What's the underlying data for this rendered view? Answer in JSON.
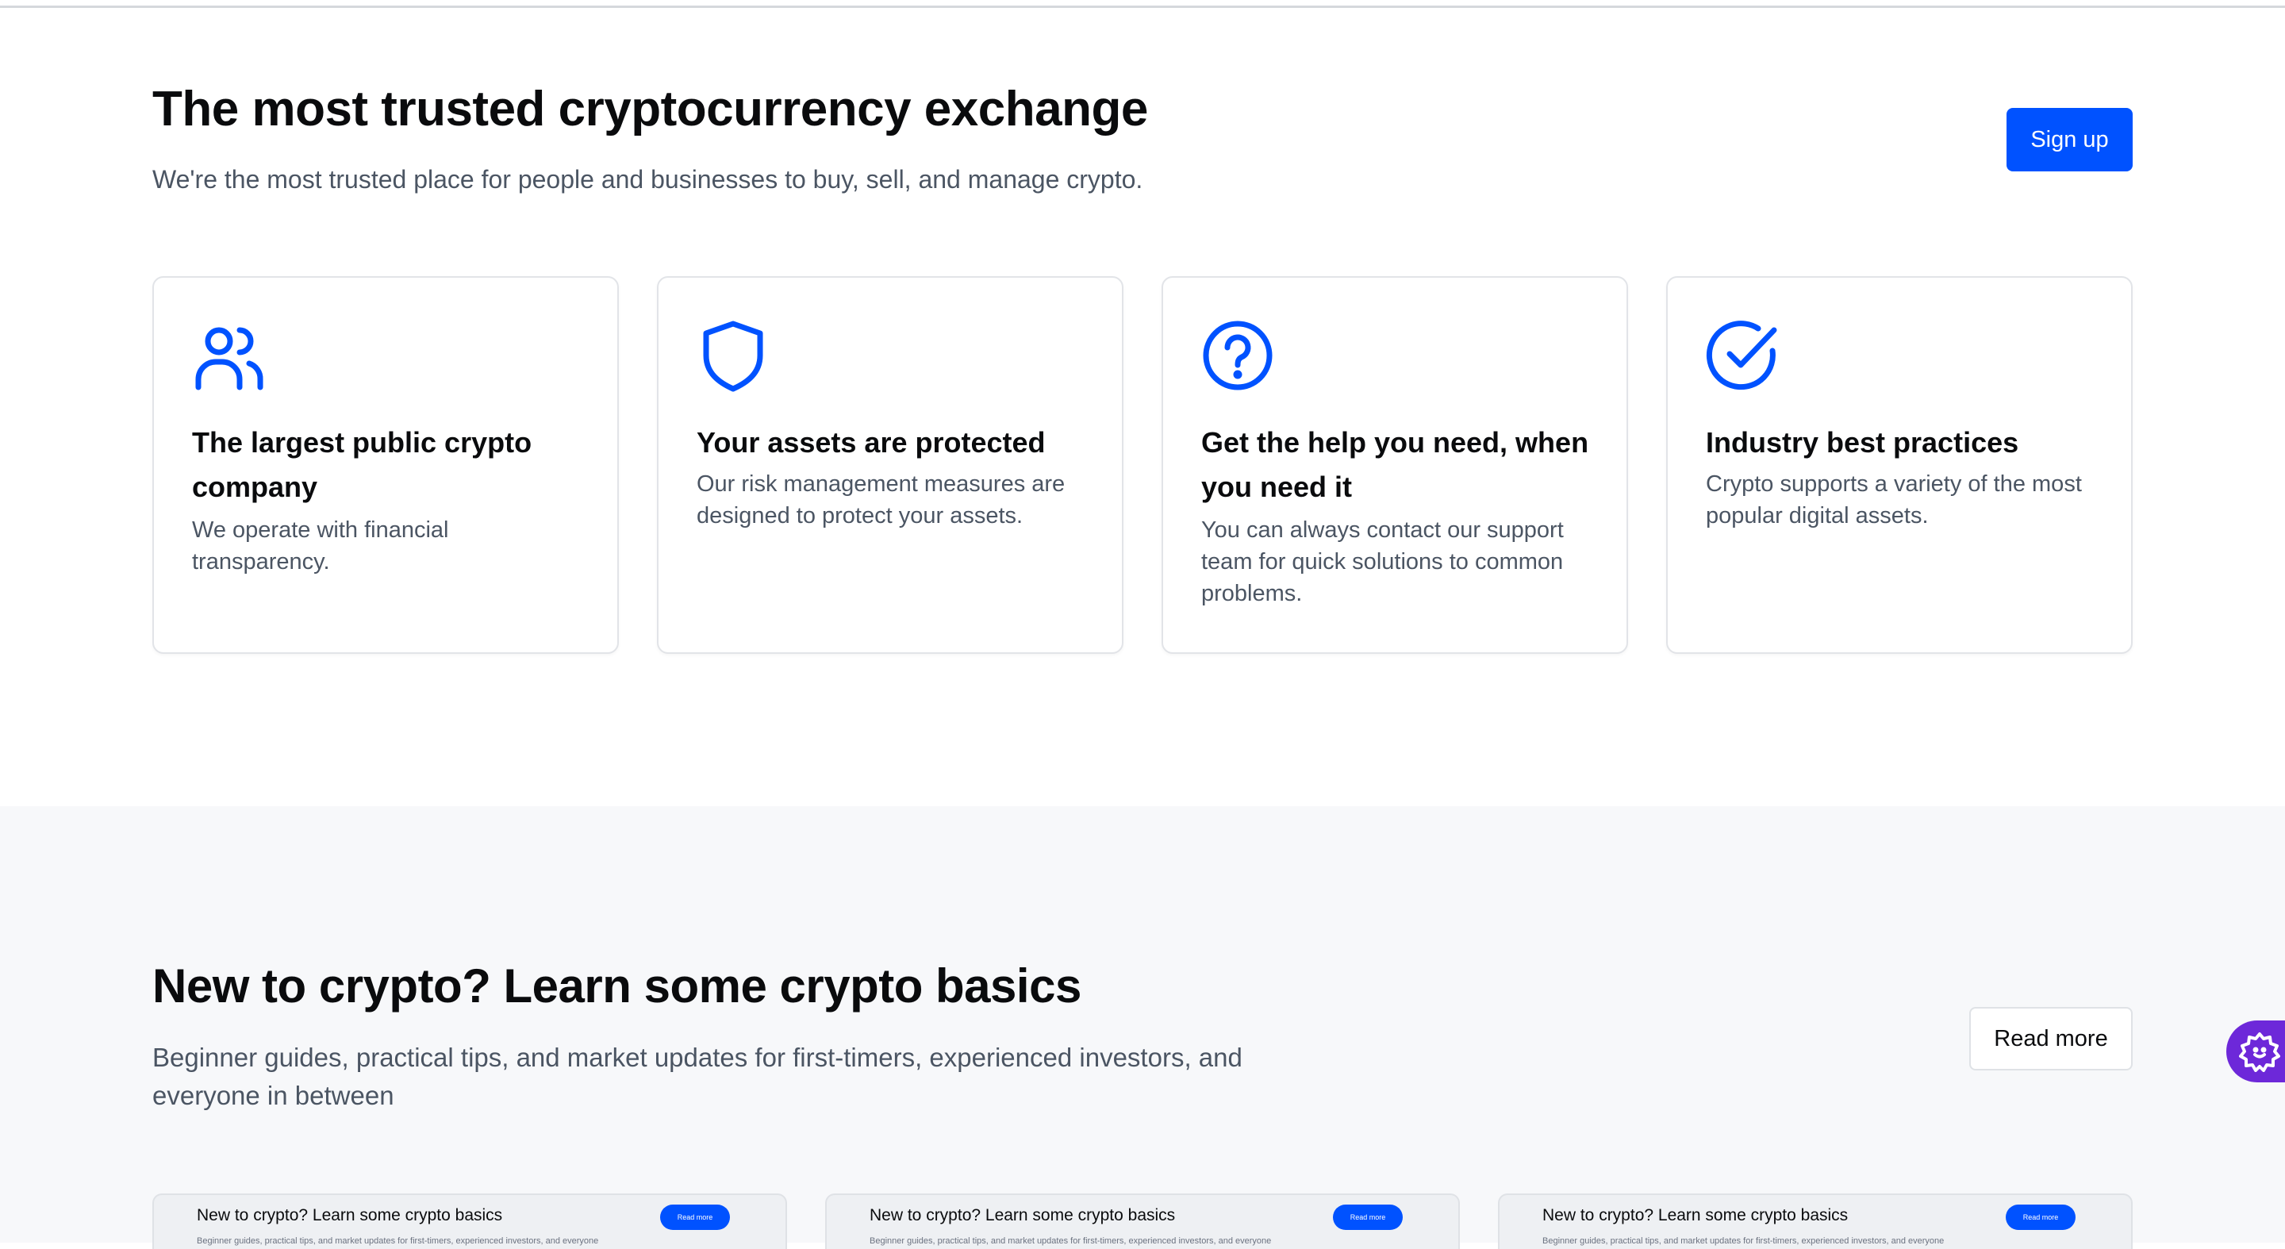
{
  "trust_section": {
    "title": "The most trusted cryptocurrency exchange",
    "subtitle": "We're the most trusted place for people and businesses to buy, sell, and manage crypto.",
    "signup_label": "Sign up",
    "cards": [
      {
        "icon": "users-icon",
        "title": "The largest public crypto company",
        "desc": "We operate with financial transparency."
      },
      {
        "icon": "shield-icon",
        "title": "Your assets are protected",
        "desc": "Our risk management measures are designed to protect your assets."
      },
      {
        "icon": "help-circle-icon",
        "title": "Get the help you need, when you need it",
        "desc": "You can always contact our support team for quick solutions to common problems."
      },
      {
        "icon": "check-circle-icon",
        "title": "Industry best practices",
        "desc": "Crypto supports a variety of the most popular digital assets."
      }
    ]
  },
  "learn_section": {
    "title": "New to crypto? Learn some crypto basics",
    "subtitle": "Beginner guides, practical tips, and market updates for first-timers, experienced investors, and everyone in between",
    "read_more_label": "Read more",
    "thumbnails": [
      {
        "title": "New to crypto? Learn some crypto basics",
        "button": "Read more",
        "sub": "Beginner guides, practical tips, and market updates for first-timers, experienced investors, and everyone"
      },
      {
        "title": "New to crypto? Learn some crypto basics",
        "button": "Read more",
        "sub": "Beginner guides, practical tips, and market updates for first-timers, experienced investors, and everyone"
      },
      {
        "title": "New to crypto? Learn some crypto basics",
        "button": "Read more",
        "sub": "Beginner guides, practical tips, and market updates for first-timers, experienced investors, and everyone"
      }
    ]
  },
  "colors": {
    "accent": "#0052ff",
    "widget": "#6d28d9",
    "section_bg": "#f7f8fa"
  },
  "widget": {
    "icon": "gear-face-icon"
  }
}
